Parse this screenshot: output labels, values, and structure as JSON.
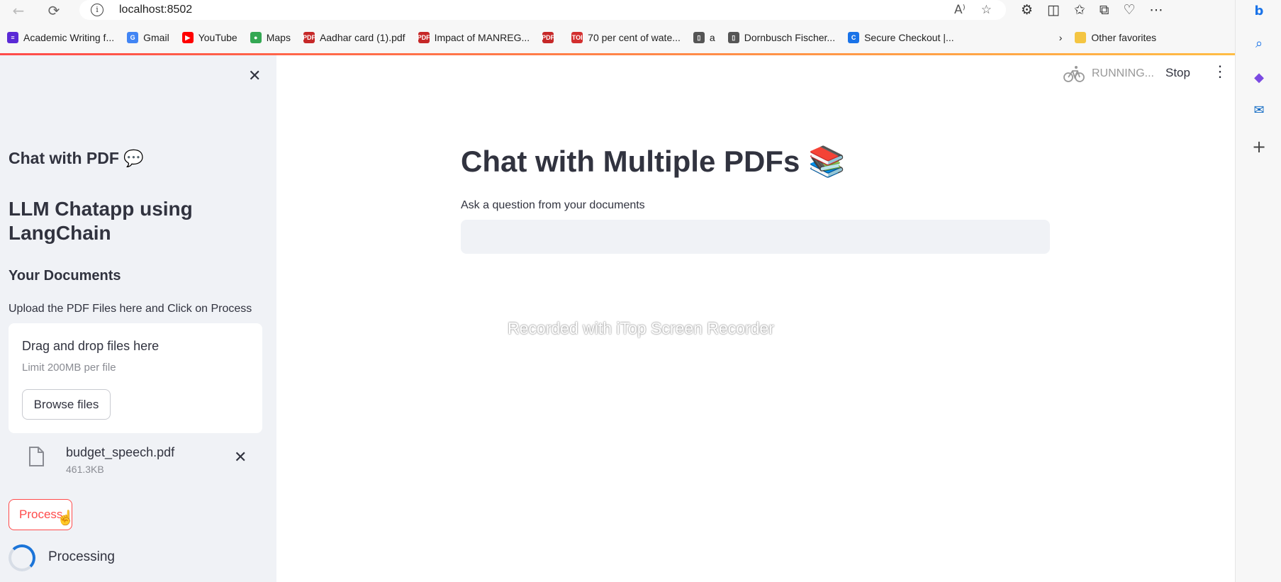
{
  "browser": {
    "url": "localhost:8502",
    "bookmarks": [
      {
        "label": "Academic Writing f...",
        "icon": "list-icon",
        "color": "#5b2ad6"
      },
      {
        "label": "Gmail",
        "icon": "google-icon",
        "color": "#4285f4"
      },
      {
        "label": "YouTube",
        "icon": "youtube-icon",
        "color": "#ff0000"
      },
      {
        "label": "Maps",
        "icon": "maps-icon",
        "color": "#34a853"
      },
      {
        "label": "Aadhar card (1).pdf",
        "icon": "pdf-icon",
        "color": "#c62828"
      },
      {
        "label": "Impact of MANREG...",
        "icon": "pdf-icon",
        "color": "#c62828"
      },
      {
        "label": "",
        "icon": "pdf-icon",
        "color": "#c62828"
      },
      {
        "label": "70 per cent of wate...",
        "icon": "toi-icon",
        "color": "#d32f2f"
      },
      {
        "label": "a",
        "icon": "page-icon",
        "color": "#555555"
      },
      {
        "label": "Dornbusch Fischer...",
        "icon": "page-icon",
        "color": "#555555"
      },
      {
        "label": "Secure Checkout |...",
        "icon": "checkout-icon",
        "color": "#1a73e8"
      }
    ],
    "other_favorites": "Other favorites"
  },
  "sidebar": {
    "title": "Chat with PDF 💬",
    "subheader": "LLM Chatapp using LangChain",
    "documents_header": "Your Documents",
    "upload_help": "Upload the PDF Files here and Click on Process",
    "dropzone_title": "Drag and drop files here",
    "dropzone_limit": "Limit 200MB per file",
    "browse_label": "Browse files",
    "file": {
      "name": "budget_speech.pdf",
      "size": "461.3KB"
    },
    "process_label": "Process",
    "processing_text": "Processing"
  },
  "main": {
    "status": "RUNNING...",
    "stop_label": "Stop",
    "title": "Chat with Multiple PDFs 📚",
    "input_label": "Ask a question from your documents",
    "input_value": "",
    "watermark": "Recorded with iTop Screen Recorder"
  },
  "colors": {
    "accent": "#ff4b4b",
    "sidebar_bg": "#f0f2f6",
    "text": "#31333f",
    "spinner": "#1b74d8"
  }
}
